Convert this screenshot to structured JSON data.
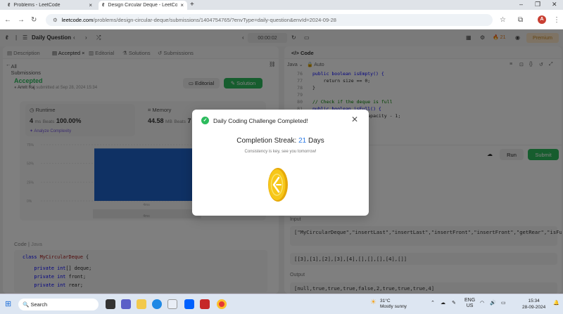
{
  "browser": {
    "tabs": [
      {
        "title": "Problems - LeetCode"
      },
      {
        "title": "Design Circular Deque - LeetCo"
      }
    ],
    "url": {
      "domain": "leetcode.com",
      "path": "/problems/design-circular-deque/submissions/1404754765/?envType=daily-question&envId=2024-09-28"
    },
    "profile_initial": "A"
  },
  "lc_header": {
    "title": "Daily Question",
    "timer": "00:00:02",
    "streak": "21",
    "premium": "Premium"
  },
  "left": {
    "tabs": [
      "Description",
      "Accepted",
      "Editorial",
      "Solutions",
      "Submissions"
    ],
    "back_label": "All Submissions",
    "status": "Accepted",
    "user": "Amrit Raj",
    "submitted": "submitted at Sep 28, 2024 15:34",
    "editorial_btn": "Editorial",
    "solution_btn": "Solution",
    "runtime": {
      "label": "Runtime",
      "value": "4",
      "unit": "ms",
      "beats_label": "Beats",
      "beats": "100.00%"
    },
    "memory": {
      "label": "Memory",
      "value": "44.58",
      "unit": "MB",
      "beats_label": "Beats",
      "beats": "7"
    },
    "analyze": "Analyze Complexity",
    "chart_data": {
      "type": "bar",
      "categories": [
        "4ms"
      ],
      "values": [
        70
      ],
      "ylim": [
        0,
        75
      ],
      "ytick_labels": [
        "75%",
        "50%",
        "25%",
        "0%"
      ],
      "tick_values": [
        75,
        50,
        25,
        0
      ],
      "xtick_labels": [
        "4ms",
        "4ms"
      ]
    },
    "code_label": "Code",
    "code_lang": "Java",
    "code_lines": [
      "class MyCircularDeque {",
      "    private int[] deque;",
      "    private int front;",
      "    private int rear;"
    ]
  },
  "right": {
    "title": "Code",
    "lang": "Java",
    "mode": "Auto",
    "editor_lines": [
      {
        "n": "76",
        "code": "public boolean isEmpty() {"
      },
      {
        "n": "77",
        "code": "    return size == 0;"
      },
      {
        "n": "78",
        "code": "}"
      },
      {
        "n": "79",
        "code": ""
      },
      {
        "n": "80",
        "code": "// Check if the deque is full"
      },
      {
        "n": "81",
        "code": "public boolean isFull() {"
      },
      {
        "n": "82",
        "code": "    return size == capacity - 1;"
      }
    ],
    "run_btn": "Run",
    "submit_btn": "Submit",
    "input_label": "Input",
    "input_ops": "[\"MyCircularDeque\",\"insertLast\",\"insertLast\",\"insertFront\",\"insertFront\",\"getRear\",\"isFull\",\"deleteLast\",\"insertFront\",\"getFront\"]",
    "input_args": "[[3],[1],[2],[3],[4],[],[],[],[4],[]]",
    "output_label": "Output",
    "output": "[null,true,true,true,false,2,true,true,true,4]"
  },
  "modal": {
    "title": "Daily Coding Challenge Completed!",
    "streak_label": "Completion Streak:",
    "streak_value": "21",
    "streak_unit": "Days",
    "subtitle": "Consistency is key, see you tomorrow!"
  },
  "taskbar": {
    "search": "Search",
    "weather_temp": "31°C",
    "weather_desc": "Mostly sunny",
    "lang_top": "ENG",
    "lang_bottom": "US",
    "time": "15:34",
    "date": "28-09-2024"
  }
}
